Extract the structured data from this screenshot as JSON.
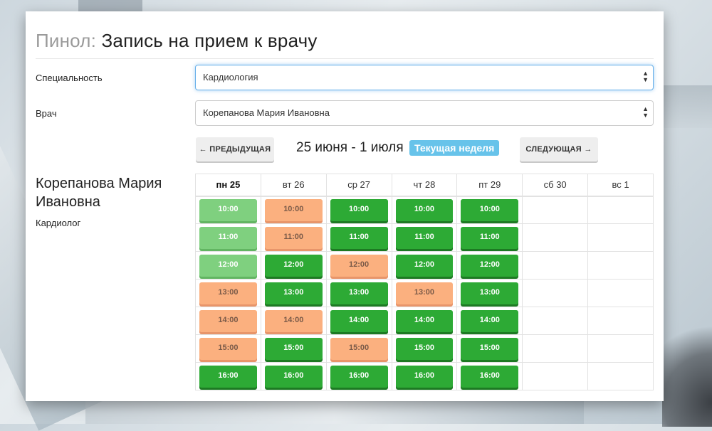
{
  "header": {
    "brand": "Пинол:",
    "title": "Запись на прием к врачу"
  },
  "specialty": {
    "label": "Специальность",
    "value": "Кардиология"
  },
  "doctor": {
    "label": "Врач",
    "value": "Корепанова Мария Ивановна"
  },
  "week_nav": {
    "prev_label": "← ПРЕДЫДУЩАЯ",
    "next_label": "СЛЕДУЮЩАЯ →",
    "range": "25 июня - 1 июля",
    "current_badge": "Текущая неделя"
  },
  "doctor_card": {
    "name": "Корепанова Мария Ивановна",
    "specialty": "Кардиолог"
  },
  "schedule": {
    "days": [
      {
        "weekday": "пн",
        "date": "25",
        "today": true
      },
      {
        "weekday": "вт",
        "date": "26"
      },
      {
        "weekday": "ср",
        "date": "27"
      },
      {
        "weekday": "чт",
        "date": "28"
      },
      {
        "weekday": "пт",
        "date": "29"
      },
      {
        "weekday": "сб",
        "date": "30"
      },
      {
        "weekday": "вс",
        "date": "1"
      }
    ],
    "times": [
      "10:00",
      "11:00",
      "12:00",
      "13:00",
      "14:00",
      "15:00",
      "16:00"
    ],
    "slot_status": [
      [
        "past",
        "busy",
        "free",
        "free",
        "free",
        "",
        ""
      ],
      [
        "past",
        "busy",
        "free",
        "free",
        "free",
        "",
        ""
      ],
      [
        "past",
        "free",
        "busy",
        "free",
        "free",
        "",
        ""
      ],
      [
        "busy",
        "free",
        "free",
        "busy",
        "free",
        "",
        ""
      ],
      [
        "busy",
        "busy",
        "free",
        "free",
        "free",
        "",
        ""
      ],
      [
        "busy",
        "free",
        "busy",
        "free",
        "free",
        "",
        ""
      ],
      [
        "free",
        "free",
        "free",
        "free",
        "free",
        "",
        ""
      ]
    ],
    "colors": {
      "free": "#2daa35",
      "past": "#7fd07f",
      "busy": "#fbb07f"
    }
  }
}
